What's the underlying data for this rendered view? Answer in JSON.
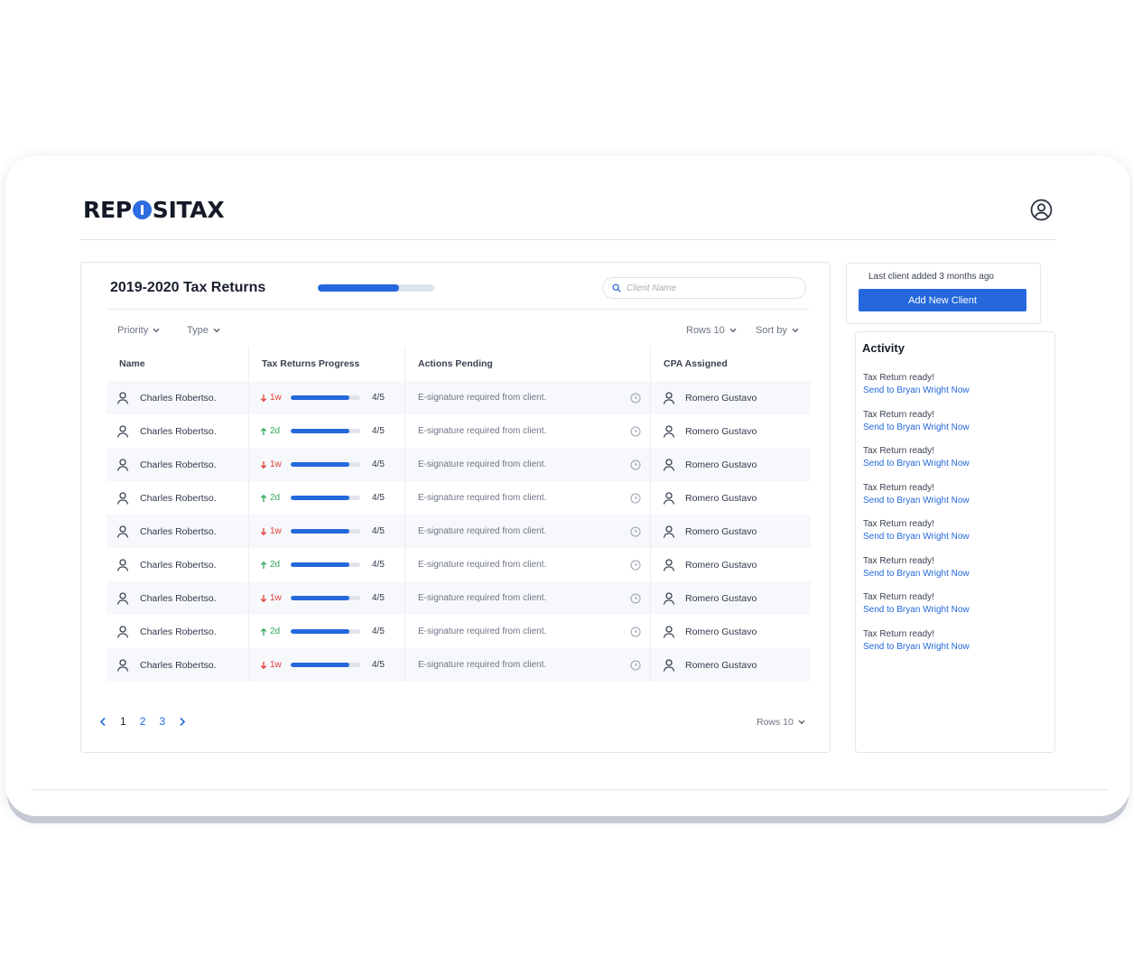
{
  "brand": {
    "name": "REPOSITAX",
    "accent": "#2468dc"
  },
  "header": {
    "profile_icon": "user-circle-icon"
  },
  "main": {
    "title": "2019-2020 Tax Returns",
    "overall_progress": 0.7,
    "search_placeholder": "Client Name",
    "filters": {
      "priority": "Priority",
      "type": "Type",
      "rows": "Rows 10",
      "sort": "Sort by"
    },
    "columns": [
      "Name",
      "Tax Returns Progress",
      "Actions Pending",
      "CPA Assigned"
    ],
    "rows": [
      {
        "name": "Charles Robertso.",
        "trend": "down",
        "trend_label": "1w",
        "progress": 0.85,
        "fraction": "4/5",
        "action": "E-signature required from client.",
        "cpa": "Romero Gustavo"
      },
      {
        "name": "Charles Robertso.",
        "trend": "up",
        "trend_label": "2d",
        "progress": 0.85,
        "fraction": "4/5",
        "action": "E-signature required from client.",
        "cpa": "Romero Gustavo"
      },
      {
        "name": "Charles Robertso.",
        "trend": "down",
        "trend_label": "1w",
        "progress": 0.85,
        "fraction": "4/5",
        "action": "E-signature required from client.",
        "cpa": "Romero Gustavo"
      },
      {
        "name": "Charles Robertso.",
        "trend": "up",
        "trend_label": "2d",
        "progress": 0.85,
        "fraction": "4/5",
        "action": "E-signature required from client.",
        "cpa": "Romero Gustavo"
      },
      {
        "name": "Charles Robertso.",
        "trend": "down",
        "trend_label": "1w",
        "progress": 0.85,
        "fraction": "4/5",
        "action": "E-signature required from client.",
        "cpa": "Romero Gustavo"
      },
      {
        "name": "Charles Robertso.",
        "trend": "up",
        "trend_label": "2d",
        "progress": 0.85,
        "fraction": "4/5",
        "action": "E-signature required from client.",
        "cpa": "Romero Gustavo"
      },
      {
        "name": "Charles Robertso.",
        "trend": "down",
        "trend_label": "1w",
        "progress": 0.85,
        "fraction": "4/5",
        "action": "E-signature required from client.",
        "cpa": "Romero Gustavo"
      },
      {
        "name": "Charles Robertso.",
        "trend": "up",
        "trend_label": "2d",
        "progress": 0.85,
        "fraction": "4/5",
        "action": "E-signature required from client.",
        "cpa": "Romero Gustavo"
      },
      {
        "name": "Charles Robertso.",
        "trend": "down",
        "trend_label": "1w",
        "progress": 0.85,
        "fraction": "4/5",
        "action": "E-signature required from client.",
        "cpa": "Romero Gustavo"
      }
    ],
    "pagination": {
      "pages": [
        "1",
        "2",
        "3"
      ],
      "current": "1",
      "rows_label": "Rows 10"
    }
  },
  "sidebar": {
    "last_client": "Last client added 3 months ago",
    "add_button": "Add New Client",
    "activity_title": "Activity",
    "activity": [
      {
        "title": "Tax Return ready!",
        "link": "Send to Bryan Wright Now"
      },
      {
        "title": "Tax Return ready!",
        "link": "Send to Bryan Wright Now"
      },
      {
        "title": "Tax Return ready!",
        "link": "Send to Bryan Wright Now"
      },
      {
        "title": "Tax Return ready!",
        "link": "Send to Bryan Wright Now"
      },
      {
        "title": "Tax Return ready!",
        "link": "Send to Bryan Wright Now"
      },
      {
        "title": "Tax Return ready!",
        "link": "Send to Bryan Wright Now"
      },
      {
        "title": "Tax Return ready!",
        "link": "Send to Bryan Wright Now"
      },
      {
        "title": "Tax Return ready!",
        "link": "Send to Bryan Wright Now"
      }
    ]
  }
}
